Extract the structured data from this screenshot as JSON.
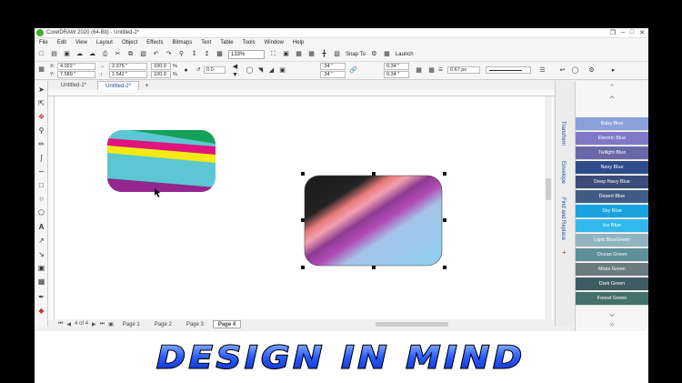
{
  "window": {
    "title": "CorelDRAW 2020 (64-Bit) - Untitled-2*",
    "controls": [
      "❐",
      "–",
      "□",
      "✕"
    ]
  },
  "menu": [
    "File",
    "Edit",
    "View",
    "Layout",
    "Object",
    "Effects",
    "Bitmaps",
    "Text",
    "Table",
    "Tools",
    "Window",
    "Help"
  ],
  "toolbar": {
    "zoom": "133%",
    "snap_to": "Snap To",
    "launch": "Launch"
  },
  "propbar": {
    "x": "4.022 \"",
    "y": "7.589 \"",
    "w": "2.375 \"",
    "h": "1.542 \"",
    "sx": "100.0",
    "sy": "100.0",
    "pct": "%",
    "angle": "0.0",
    "c1": ".34 \"",
    "c2": ".34 \"",
    "c3": "0.34 \"",
    "c4": "0.34 \"",
    "outline": "0.67 px"
  },
  "doc_tabs": [
    "Untitled-1*",
    "Untitled-2*"
  ],
  "pages": {
    "counter": "4 of 4",
    "tabs": [
      "Page 1",
      "Page 2",
      "Page 3",
      "Page 4"
    ],
    "active": 3
  },
  "dockers": {
    "transform": "Transform",
    "envelope": "Envelope",
    "find_replace": "Find and Replace"
  },
  "palette": [
    {
      "name": "Baby Blue",
      "color": "#8aa0d8"
    },
    {
      "name": "Electric Blue",
      "color": "#7d78c8"
    },
    {
      "name": "Twilight Blue",
      "color": "#6868a8"
    },
    {
      "name": "Navy Blue",
      "color": "#2e4b8c"
    },
    {
      "name": "Deep Navy Blue",
      "color": "#3a4c78"
    },
    {
      "name": "Desert Blue",
      "color": "#3f5d84"
    },
    {
      "name": "Sky Blue",
      "color": "#17a3e0"
    },
    {
      "name": "Ice Blue",
      "color": "#32b8ec"
    },
    {
      "name": "Light BlueGreen",
      "color": "#92b4c0"
    },
    {
      "name": "Ocean Green",
      "color": "#5f8f99"
    },
    {
      "name": "Moss Green",
      "color": "#6a7c80"
    },
    {
      "name": "Dark Green",
      "color": "#405c63"
    },
    {
      "name": "Forest Green",
      "color": "#44706e"
    }
  ],
  "banner": {
    "text": "DESIGN IN MIND"
  }
}
